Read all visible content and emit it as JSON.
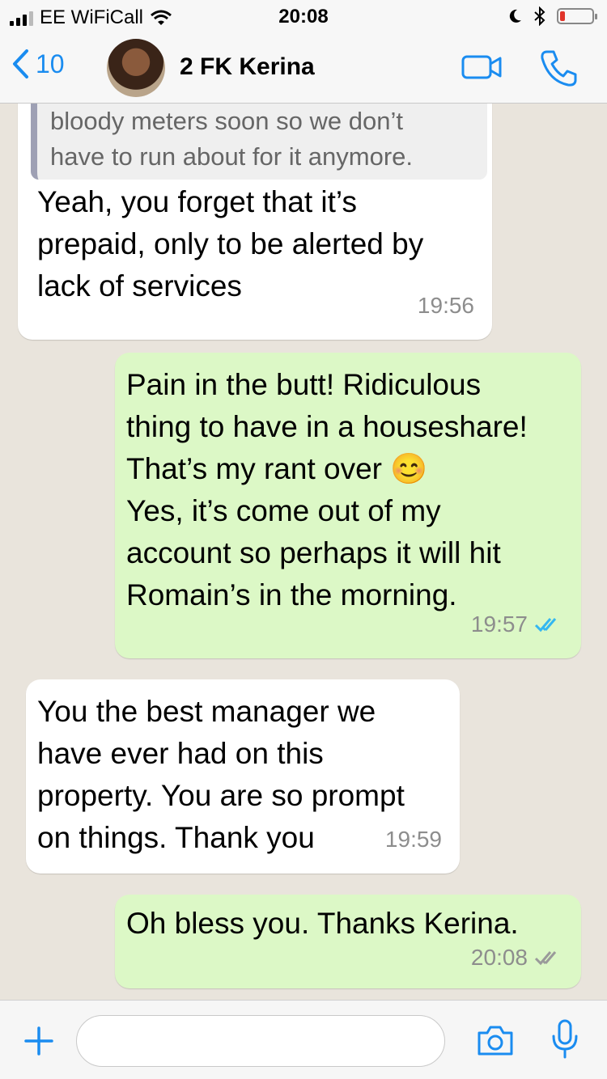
{
  "status_bar": {
    "carrier": "EE WiFiCall",
    "time": "20:08",
    "battery_level": 0.15,
    "icons": [
      "signal-icon",
      "wifi-icon",
      "moon-icon",
      "bluetooth-icon",
      "battery-icon"
    ]
  },
  "header": {
    "back_count": "10",
    "contact_name": "2 FK Kerina",
    "icons": [
      "back-chevron-icon",
      "avatar",
      "video-call-icon",
      "phone-call-icon"
    ]
  },
  "messages": [
    {
      "direction": "in",
      "quoted_text": "bloody meters soon so we don’t\nhave to run about for it anymore.",
      "text": "Yeah, you forget that it’s\nprepaid, only to be alerted by\nlack of services",
      "time": "19:56"
    },
    {
      "direction": "out",
      "text": "Pain in the butt! Ridiculous\nthing to have in a houseshare!\nThat’s my rant over 😊\nYes, it’s come out of my\naccount so perhaps it will hit\nRomain’s in the morning.",
      "time": "19:57",
      "status": "read"
    },
    {
      "direction": "in",
      "text": "You the best manager we\nhave ever had on this\nproperty. You are so prompt\non things. Thank you",
      "time": "19:59"
    },
    {
      "direction": "out",
      "text": "Oh bless you. Thanks Kerina.",
      "time": "20:08",
      "status": "delivered"
    }
  ],
  "colors": {
    "accent": "#1a8cf0",
    "outgoing_bubble": "#dcf8c6",
    "incoming_bubble": "#ffffff",
    "read_tick": "#34b7f1",
    "delivered_tick": "#9a9a9a",
    "background": "#e9e4dc"
  },
  "input_bar": {
    "placeholder": "",
    "icons": [
      "plus-icon",
      "camera-icon",
      "microphone-icon"
    ]
  }
}
